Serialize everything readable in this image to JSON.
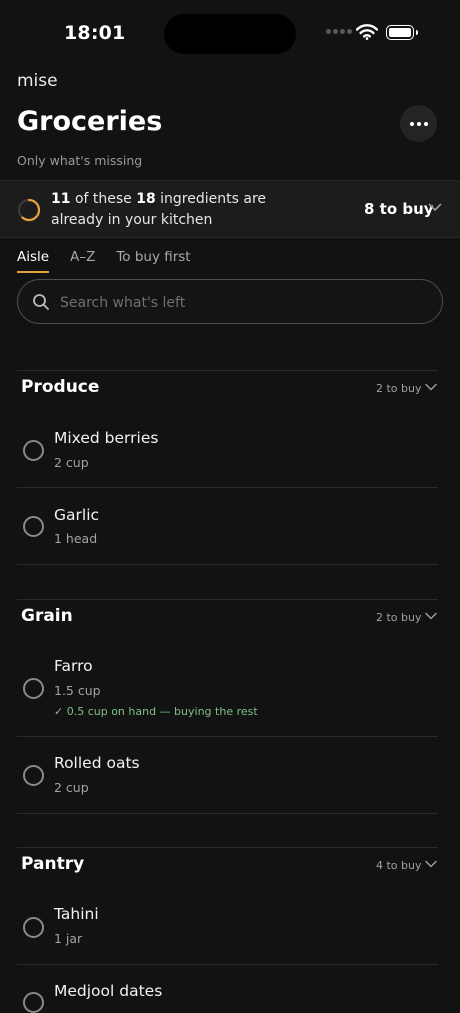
{
  "status": {
    "time": "18:01"
  },
  "header": {
    "brand": "mise",
    "title": "Groceries",
    "subtitle": "Only what's missing"
  },
  "summary": {
    "have": "11",
    "of_these": "of these",
    "total": "18",
    "rest": "ingredients are already in your kitchen",
    "buy_label": "8 to buy",
    "progress": 0.611,
    "accent": "#e6a33a"
  },
  "tabs": [
    {
      "label": "Aisle",
      "active": true
    },
    {
      "label": "A–Z",
      "active": false
    },
    {
      "label": "To buy first",
      "active": false
    }
  ],
  "search": {
    "placeholder": "Search what's left",
    "value": ""
  },
  "sections": [
    {
      "name": "Produce",
      "count": "2 to buy",
      "items": [
        {
          "name": "Mixed berries",
          "qty": "2 cup"
        },
        {
          "name": "Garlic",
          "qty": "1 head"
        }
      ]
    },
    {
      "name": "Grain",
      "count": "2 to buy",
      "items": [
        {
          "name": "Farro",
          "qty": "1.5 cup",
          "note": "✓ 0.5 cup on hand — buying the rest"
        },
        {
          "name": "Rolled oats",
          "qty": "2 cup"
        }
      ]
    },
    {
      "name": "Pantry",
      "count": "4 to buy",
      "items": [
        {
          "name": "Tahini",
          "qty": "1 jar"
        },
        {
          "name": "Medjool dates",
          "qty": ""
        }
      ]
    }
  ],
  "icons": {
    "more": "more-horizontal-icon",
    "search": "search-icon",
    "chevron": "chevron-down-icon",
    "check": "circle-checkbox-icon"
  }
}
